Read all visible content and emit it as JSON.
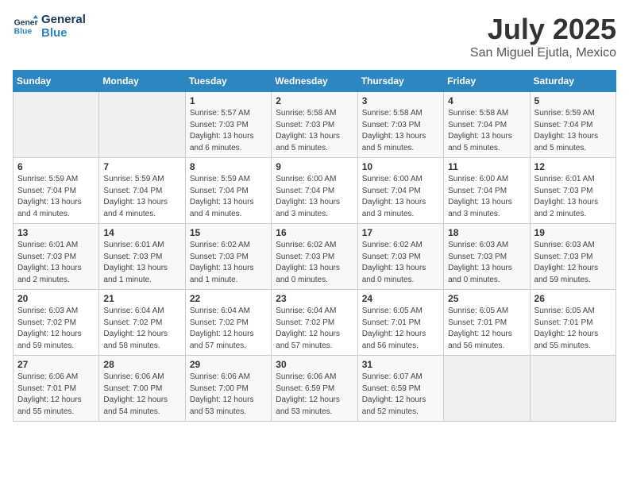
{
  "header": {
    "logo_line1": "General",
    "logo_line2": "Blue",
    "month_title": "July 2025",
    "subtitle": "San Miguel Ejutla, Mexico"
  },
  "weekdays": [
    "Sunday",
    "Monday",
    "Tuesday",
    "Wednesday",
    "Thursday",
    "Friday",
    "Saturday"
  ],
  "weeks": [
    [
      {
        "day": "",
        "detail": ""
      },
      {
        "day": "",
        "detail": ""
      },
      {
        "day": "1",
        "detail": "Sunrise: 5:57 AM\nSunset: 7:03 PM\nDaylight: 13 hours and 6 minutes."
      },
      {
        "day": "2",
        "detail": "Sunrise: 5:58 AM\nSunset: 7:03 PM\nDaylight: 13 hours and 5 minutes."
      },
      {
        "day": "3",
        "detail": "Sunrise: 5:58 AM\nSunset: 7:03 PM\nDaylight: 13 hours and 5 minutes."
      },
      {
        "day": "4",
        "detail": "Sunrise: 5:58 AM\nSunset: 7:04 PM\nDaylight: 13 hours and 5 minutes."
      },
      {
        "day": "5",
        "detail": "Sunrise: 5:59 AM\nSunset: 7:04 PM\nDaylight: 13 hours and 5 minutes."
      }
    ],
    [
      {
        "day": "6",
        "detail": "Sunrise: 5:59 AM\nSunset: 7:04 PM\nDaylight: 13 hours and 4 minutes."
      },
      {
        "day": "7",
        "detail": "Sunrise: 5:59 AM\nSunset: 7:04 PM\nDaylight: 13 hours and 4 minutes."
      },
      {
        "day": "8",
        "detail": "Sunrise: 5:59 AM\nSunset: 7:04 PM\nDaylight: 13 hours and 4 minutes."
      },
      {
        "day": "9",
        "detail": "Sunrise: 6:00 AM\nSunset: 7:04 PM\nDaylight: 13 hours and 3 minutes."
      },
      {
        "day": "10",
        "detail": "Sunrise: 6:00 AM\nSunset: 7:04 PM\nDaylight: 13 hours and 3 minutes."
      },
      {
        "day": "11",
        "detail": "Sunrise: 6:00 AM\nSunset: 7:04 PM\nDaylight: 13 hours and 3 minutes."
      },
      {
        "day": "12",
        "detail": "Sunrise: 6:01 AM\nSunset: 7:03 PM\nDaylight: 13 hours and 2 minutes."
      }
    ],
    [
      {
        "day": "13",
        "detail": "Sunrise: 6:01 AM\nSunset: 7:03 PM\nDaylight: 13 hours and 2 minutes."
      },
      {
        "day": "14",
        "detail": "Sunrise: 6:01 AM\nSunset: 7:03 PM\nDaylight: 13 hours and 1 minute."
      },
      {
        "day": "15",
        "detail": "Sunrise: 6:02 AM\nSunset: 7:03 PM\nDaylight: 13 hours and 1 minute."
      },
      {
        "day": "16",
        "detail": "Sunrise: 6:02 AM\nSunset: 7:03 PM\nDaylight: 13 hours and 0 minutes."
      },
      {
        "day": "17",
        "detail": "Sunrise: 6:02 AM\nSunset: 7:03 PM\nDaylight: 13 hours and 0 minutes."
      },
      {
        "day": "18",
        "detail": "Sunrise: 6:03 AM\nSunset: 7:03 PM\nDaylight: 13 hours and 0 minutes."
      },
      {
        "day": "19",
        "detail": "Sunrise: 6:03 AM\nSunset: 7:03 PM\nDaylight: 12 hours and 59 minutes."
      }
    ],
    [
      {
        "day": "20",
        "detail": "Sunrise: 6:03 AM\nSunset: 7:02 PM\nDaylight: 12 hours and 59 minutes."
      },
      {
        "day": "21",
        "detail": "Sunrise: 6:04 AM\nSunset: 7:02 PM\nDaylight: 12 hours and 58 minutes."
      },
      {
        "day": "22",
        "detail": "Sunrise: 6:04 AM\nSunset: 7:02 PM\nDaylight: 12 hours and 57 minutes."
      },
      {
        "day": "23",
        "detail": "Sunrise: 6:04 AM\nSunset: 7:02 PM\nDaylight: 12 hours and 57 minutes."
      },
      {
        "day": "24",
        "detail": "Sunrise: 6:05 AM\nSunset: 7:01 PM\nDaylight: 12 hours and 56 minutes."
      },
      {
        "day": "25",
        "detail": "Sunrise: 6:05 AM\nSunset: 7:01 PM\nDaylight: 12 hours and 56 minutes."
      },
      {
        "day": "26",
        "detail": "Sunrise: 6:05 AM\nSunset: 7:01 PM\nDaylight: 12 hours and 55 minutes."
      }
    ],
    [
      {
        "day": "27",
        "detail": "Sunrise: 6:06 AM\nSunset: 7:01 PM\nDaylight: 12 hours and 55 minutes."
      },
      {
        "day": "28",
        "detail": "Sunrise: 6:06 AM\nSunset: 7:00 PM\nDaylight: 12 hours and 54 minutes."
      },
      {
        "day": "29",
        "detail": "Sunrise: 6:06 AM\nSunset: 7:00 PM\nDaylight: 12 hours and 53 minutes."
      },
      {
        "day": "30",
        "detail": "Sunrise: 6:06 AM\nSunset: 6:59 PM\nDaylight: 12 hours and 53 minutes."
      },
      {
        "day": "31",
        "detail": "Sunrise: 6:07 AM\nSunset: 6:59 PM\nDaylight: 12 hours and 52 minutes."
      },
      {
        "day": "",
        "detail": ""
      },
      {
        "day": "",
        "detail": ""
      }
    ]
  ]
}
